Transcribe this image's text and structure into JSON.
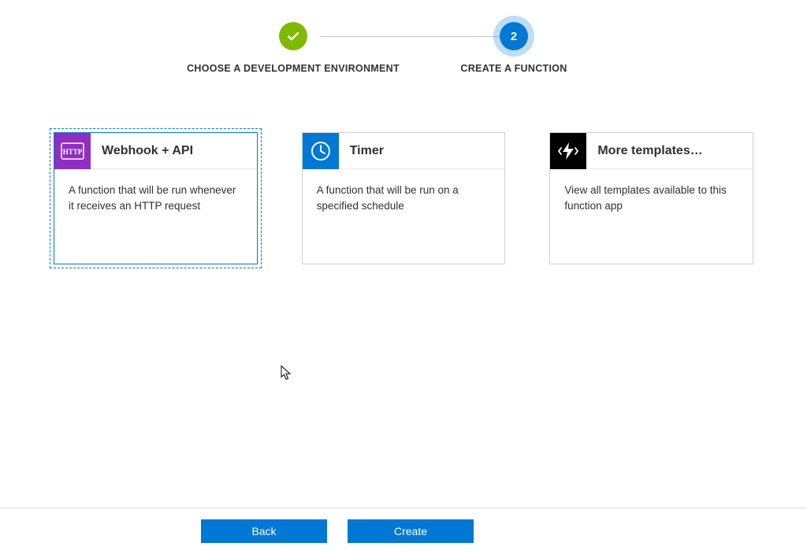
{
  "stepper": {
    "step1_label": "CHOOSE A DEVELOPMENT ENVIRONMENT",
    "step2_label": "CREATE A FUNCTION",
    "step2_number": "2"
  },
  "cards": {
    "webhook": {
      "title": "Webhook + API",
      "desc": "A function that will be run whenever it receives an HTTP request"
    },
    "timer": {
      "title": "Timer",
      "desc": "A function that will be run on a specified schedule"
    },
    "more": {
      "title": "More templates…",
      "desc": "View all templates available to this function app"
    }
  },
  "footer": {
    "back_label": "Back",
    "create_label": "Create"
  }
}
